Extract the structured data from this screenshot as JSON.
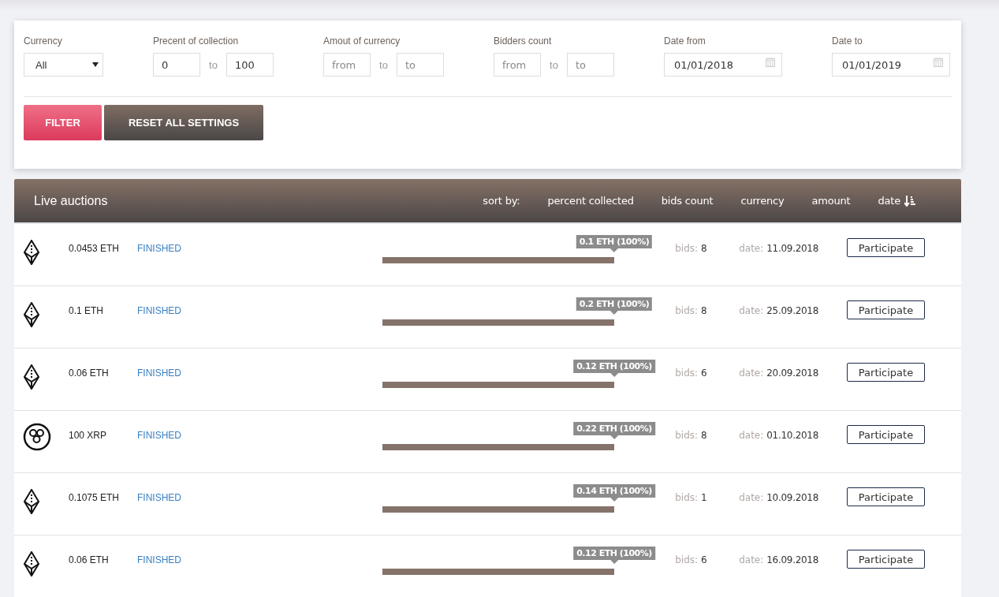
{
  "filters": [
    {
      "kind": "select",
      "label": "Currency",
      "value": "All"
    },
    {
      "kind": "range",
      "label": "Precent of collection",
      "from": {
        "value": "0"
      },
      "separator": "to",
      "to": {
        "value": "100"
      }
    },
    {
      "kind": "range",
      "label": "Amout of currency",
      "from": {
        "placeholder": "from"
      },
      "separator": "to",
      "to": {
        "placeholder": "to"
      }
    },
    {
      "kind": "range",
      "label": "Bidders count",
      "from": {
        "placeholder": "from"
      },
      "separator": "to",
      "to": {
        "placeholder": "to"
      }
    },
    {
      "kind": "date",
      "label": "Date from",
      "value": "01/01/2018"
    },
    {
      "kind": "date",
      "label": "Date to",
      "value": "01/01/2019"
    }
  ],
  "buttons": {
    "filter": "FILTER",
    "reset": "RESET ALL SETTINGS"
  },
  "auctions": {
    "title": "Live auctions",
    "sort_label": "sort by:",
    "sort_options": [
      {
        "label": "percent collected",
        "selected": false
      },
      {
        "label": "bids count",
        "selected": false
      },
      {
        "label": "currency",
        "selected": false
      },
      {
        "label": "amount",
        "selected": false
      },
      {
        "label": "date",
        "selected": true
      }
    ],
    "rows": [
      {
        "kind": "eth",
        "amount": "0.0453 ETH",
        "status": "FINISHED",
        "level": 1,
        "tooltip": "0.1 ETH (100%)",
        "bids_label": "bids:",
        "bids": "8",
        "date_label": "date:",
        "date": "11.09.2018",
        "action": "Participate"
      },
      {
        "kind": "eth",
        "amount": "0.1 ETH",
        "status": "FINISHED",
        "level": 1,
        "tooltip": "0.2 ETH (100%)",
        "bids_label": "bids:",
        "bids": "8",
        "date_label": "date:",
        "date": "25.09.2018",
        "action": "Participate"
      },
      {
        "kind": "eth",
        "amount": "0.06 ETH",
        "status": "FINISHED",
        "level": 1,
        "tooltip": "0.12 ETH (100%)",
        "bids_label": "bids:",
        "bids": "6",
        "date_label": "date:",
        "date": "20.09.2018",
        "action": "Participate"
      },
      {
        "kind": "xrp",
        "amount": "100 XRP",
        "status": "FINISHED",
        "level": 1,
        "tooltip": "0.22 ETH (100%)",
        "bids_label": "bids:",
        "bids": "8",
        "date_label": "date:",
        "date": "01.10.2018",
        "action": "Participate"
      },
      {
        "kind": "eth",
        "amount": "0.1075 ETH",
        "status": "FINISHED",
        "level": 1,
        "tooltip": "0.14 ETH (100%)",
        "bids_label": "bids:",
        "bids": "1",
        "date_label": "date:",
        "date": "10.09.2018",
        "action": "Participate"
      },
      {
        "kind": "eth",
        "amount": "0.06 ETH",
        "status": "FINISHED",
        "level": 1,
        "tooltip": "0.12 ETH (100%)",
        "bids_label": "bids:",
        "bids": "6",
        "date_label": "date:",
        "date": "16.09.2018",
        "action": "Participate"
      }
    ]
  }
}
